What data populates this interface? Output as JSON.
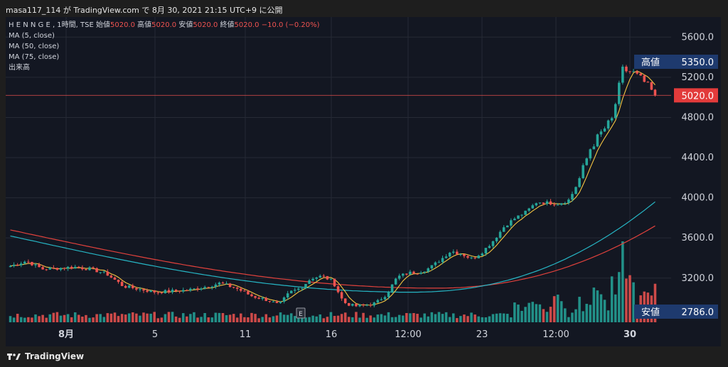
{
  "byline": "masa117_114 が TradingView.com で 8月 30, 2021 21:15 UTC+9 に公開",
  "legend": {
    "symbol": "H E N N G E , 1時間, TSE",
    "open_label": "始値",
    "open": "5020.0",
    "high_label": "高値",
    "high": "5020.0",
    "low_label": "安値",
    "low": "5020.0",
    "close_label": "終値",
    "close": "5020.0",
    "change": "−10.0 (−0.20%)",
    "indicators": [
      "MA (5, close)",
      "MA (50, close)",
      "MA (75, close)",
      "出来高"
    ]
  },
  "footer": {
    "brand": "TradingView"
  },
  "colors": {
    "up": "#26a69a",
    "down": "#ef5350",
    "ma5": "#f5c542",
    "ma50": "#26b5c4",
    "ma75": "#e0413c",
    "background": "#131722",
    "grid": "#262a35"
  },
  "chart_data": {
    "type": "candlestick",
    "y_ticks": [
      "5600.0",
      "5200.0",
      "4800.0",
      "4400.0",
      "4000.0",
      "3600.0",
      "3200.0"
    ],
    "ylim": [
      2760,
      5800
    ],
    "x_ticks": [
      "8月",
      "5",
      "11",
      "16",
      "12:00",
      "23",
      "12:00",
      "30"
    ],
    "price_labels": {
      "high": {
        "label": "高値",
        "value": "5350.0"
      },
      "current": {
        "value": "5020.0"
      },
      "low": {
        "label": "安値",
        "value": "2786.0"
      }
    },
    "event_marker": "E",
    "candles": [],
    "ma5": [],
    "ma50": [],
    "ma75": [],
    "volume": []
  }
}
